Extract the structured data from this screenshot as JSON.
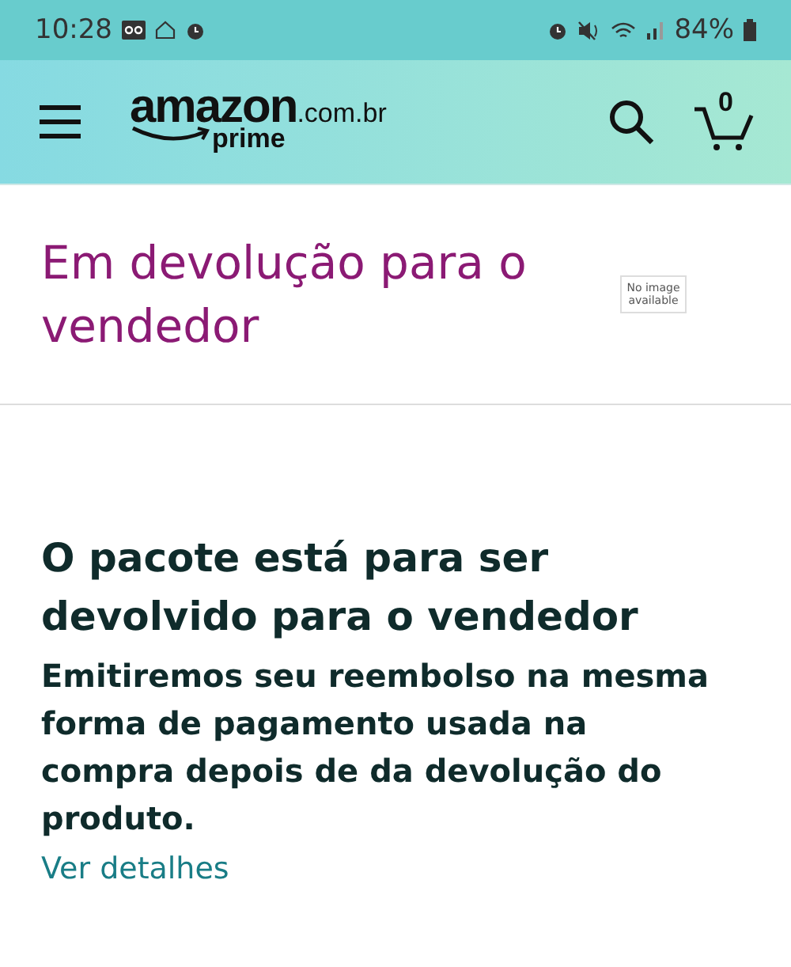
{
  "status_bar": {
    "time": "10:28",
    "battery": "84%"
  },
  "header": {
    "logo": "amazon",
    "domain": ".com.br",
    "tier": "prime",
    "cart_count": "0"
  },
  "title": "Em devolução para o vendedor",
  "image": {
    "placeholder": "No image available"
  },
  "status": {
    "heading": "O pacote está para ser devolvido para o vendedor",
    "message": "Emitiremos seu reembolso na mesma forma de pagamento usada na compra depois de da devolução do produto.",
    "link": "Ver detalhes"
  }
}
